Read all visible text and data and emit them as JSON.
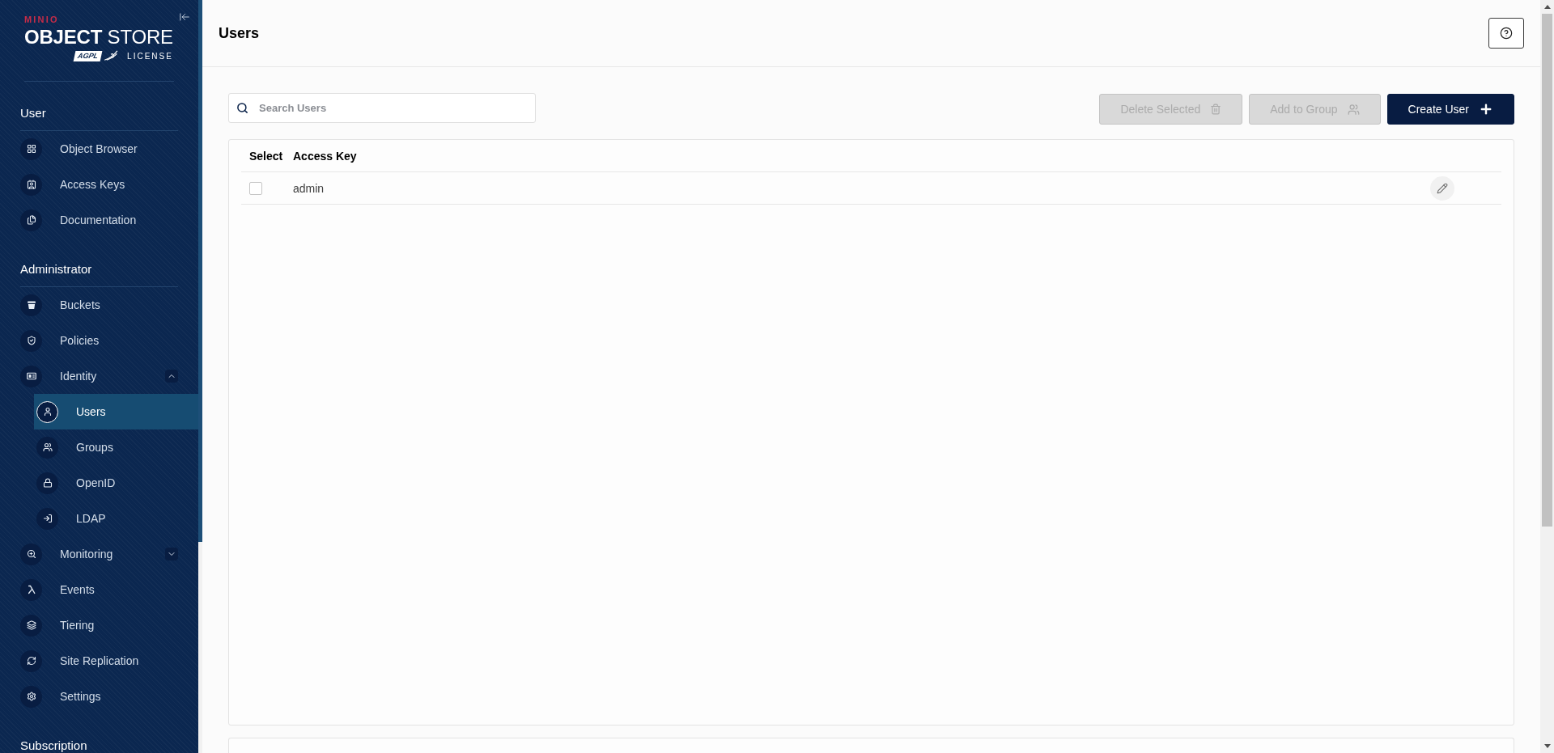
{
  "sidebar": {
    "logo": {
      "brand": "MINIO",
      "product": "**OBJECT** STORE",
      "badge": "AGPL",
      "license": "LICENSE"
    },
    "sections": [
      {
        "title": "User",
        "items": [
          {
            "label": "Object Browser",
            "selected": false
          },
          {
            "label": "Access Keys",
            "selected": false
          },
          {
            "label": "Documentation",
            "selected": false
          }
        ]
      },
      {
        "title": "Administrator",
        "items": [
          {
            "label": "Buckets",
            "selected": false
          },
          {
            "label": "Policies",
            "selected": false
          },
          {
            "label": "Identity",
            "selected": false,
            "expanded": true,
            "children": [
              {
                "label": "Users",
                "selected": true
              },
              {
                "label": "Groups",
                "selected": false
              },
              {
                "label": "OpenID",
                "selected": false
              },
              {
                "label": "LDAP",
                "selected": false
              }
            ]
          },
          {
            "label": "Monitoring",
            "selected": false,
            "expanded": false
          },
          {
            "label": "Events",
            "selected": false
          },
          {
            "label": "Tiering",
            "selected": false
          },
          {
            "label": "Site Replication",
            "selected": false
          },
          {
            "label": "Settings",
            "selected": false
          }
        ]
      },
      {
        "title": "Subscription"
      }
    ]
  },
  "header": {
    "title": "Users"
  },
  "toolbar": {
    "search": {
      "placeholder": "Search Users"
    },
    "buttons": [
      {
        "kind": "delete",
        "label": "Delete Selected",
        "disabled": true
      },
      {
        "kind": "add",
        "label": "Add to Group",
        "disabled": true
      },
      {
        "kind": "create",
        "label": "Create User",
        "disabled": false
      }
    ]
  },
  "table": {
    "columns": [
      "Select",
      "Access Key"
    ],
    "rows": [
      {
        "checked": false,
        "access_key": "admin"
      }
    ]
  }
}
